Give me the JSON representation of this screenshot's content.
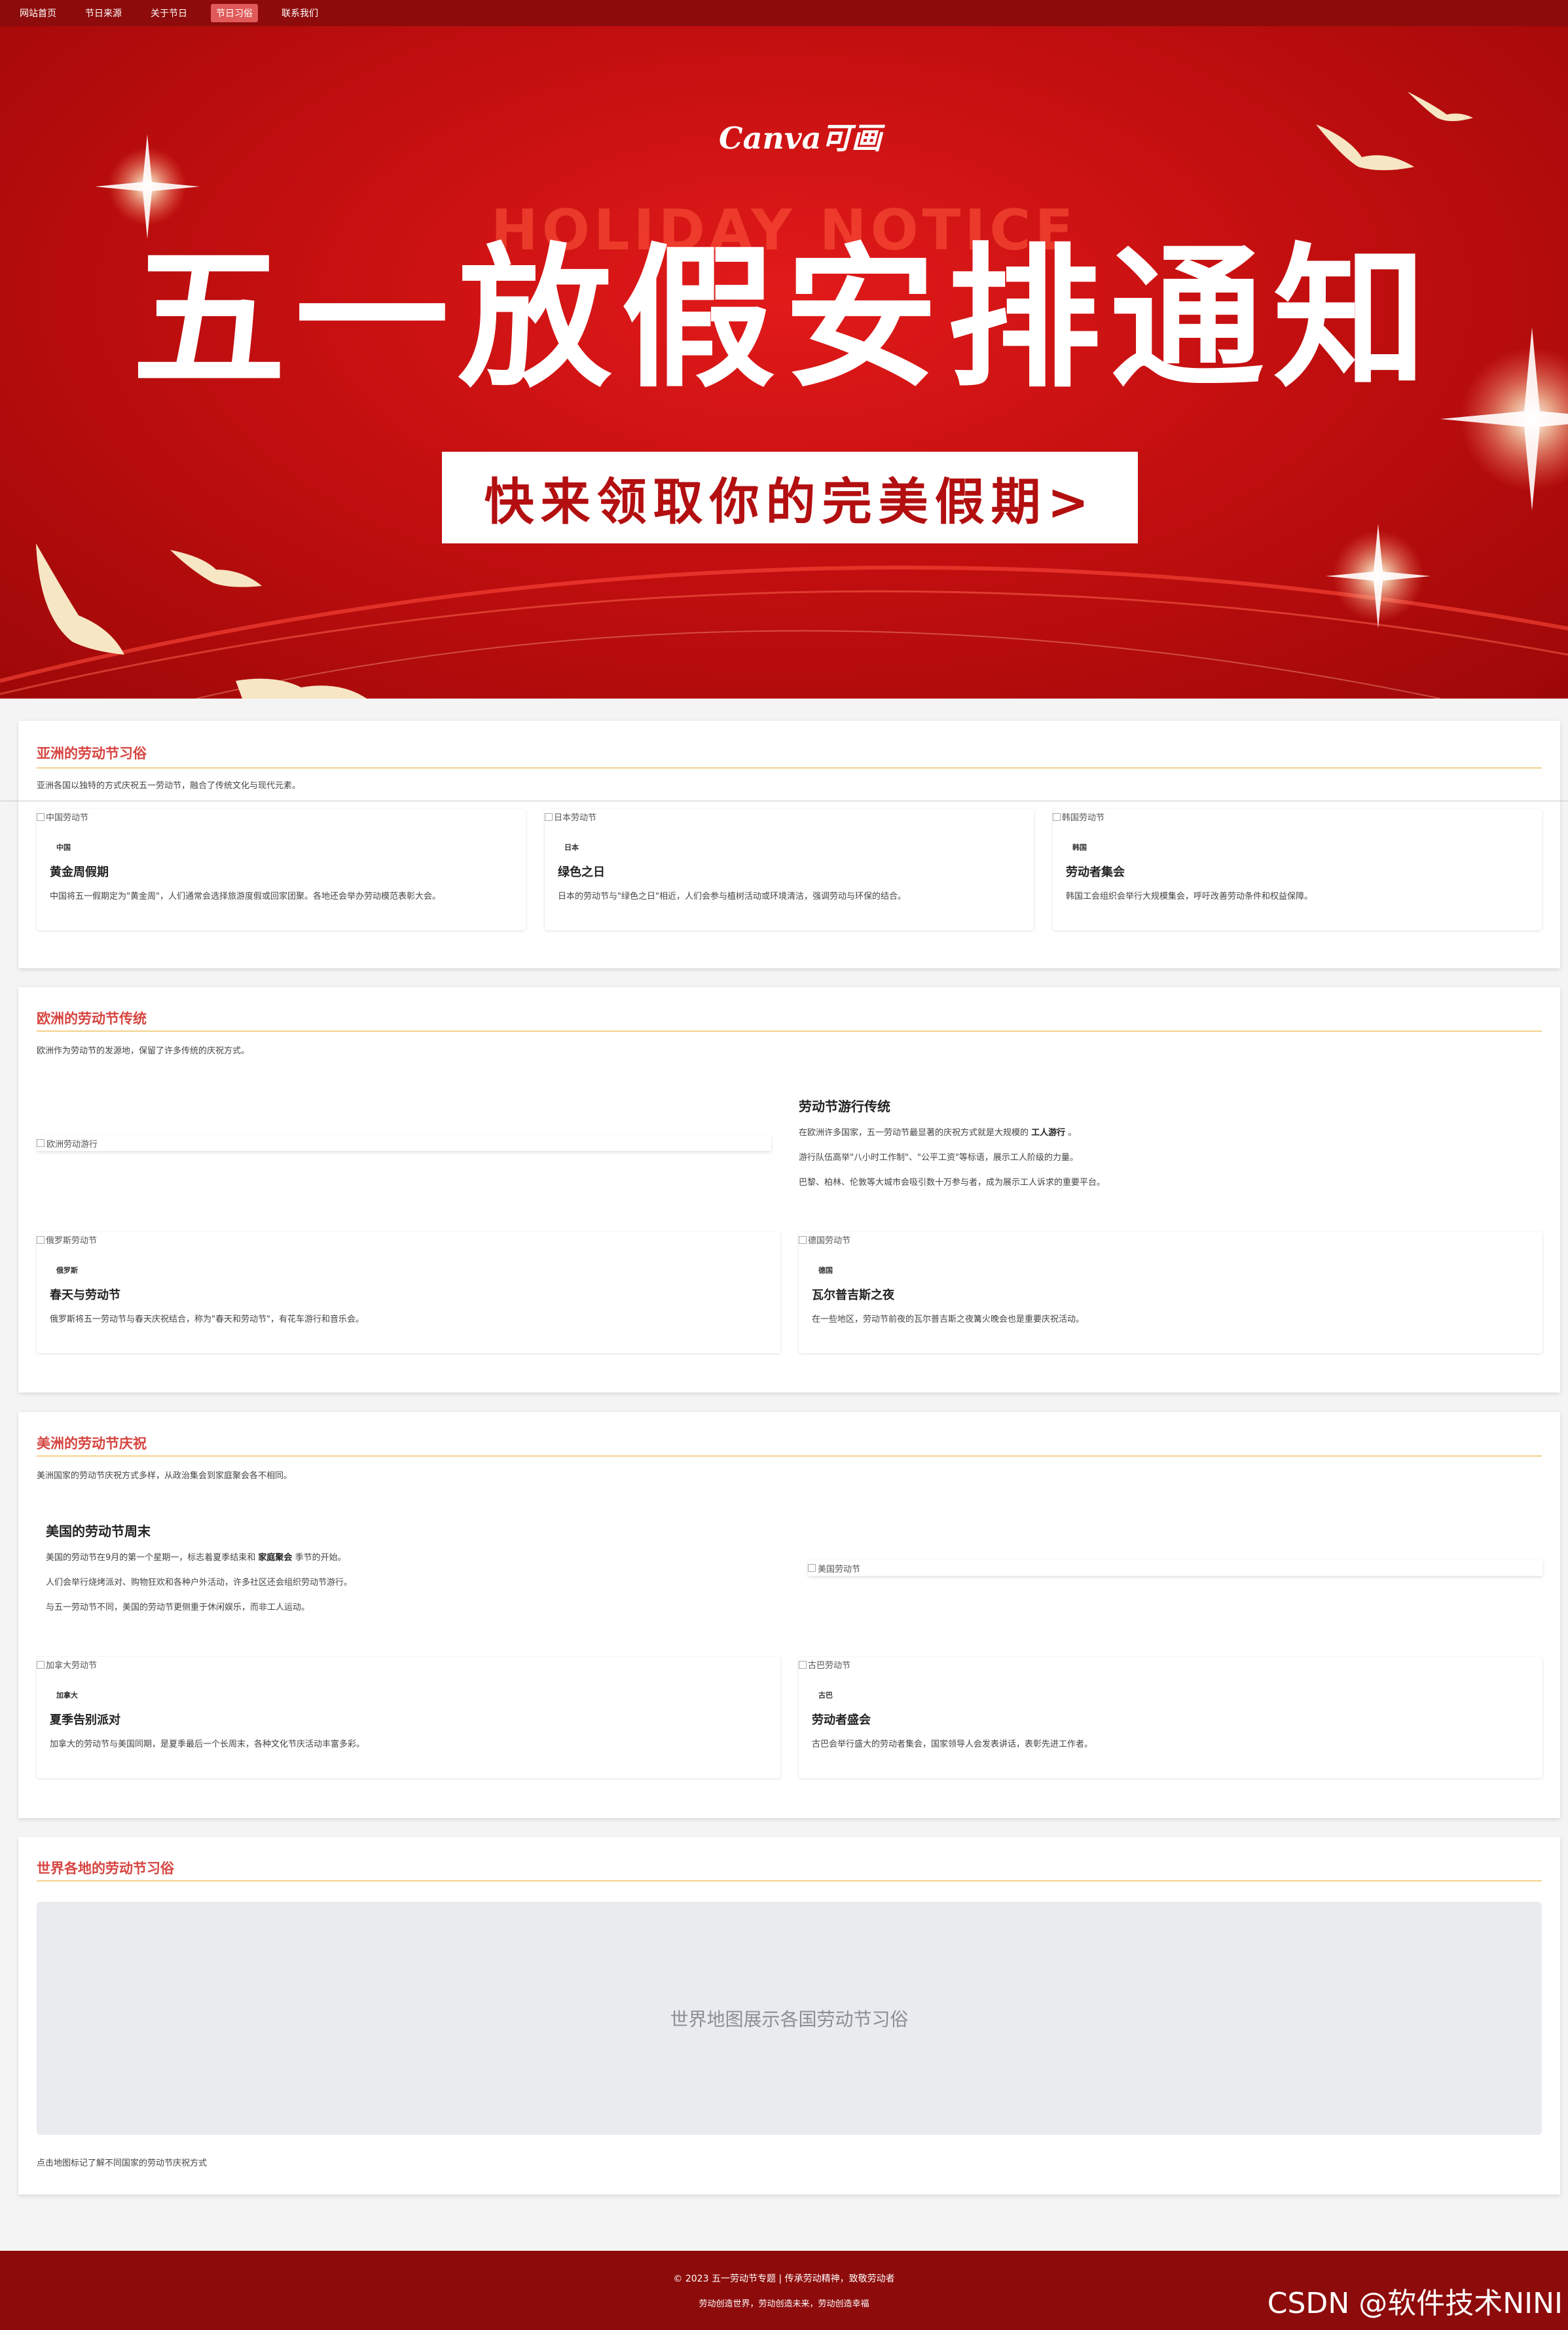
{
  "nav": {
    "items": [
      {
        "label": "网站首页",
        "active": false
      },
      {
        "label": "节日来源",
        "active": false
      },
      {
        "label": "关于节日",
        "active": false
      },
      {
        "label": "节日习俗",
        "active": true
      },
      {
        "label": "联系我们",
        "active": false
      }
    ]
  },
  "hero": {
    "logo": "Canva可画",
    "subtitle": "HOLIDAY NOTICE",
    "title": "五一放假安排通知",
    "cta": "快来领取你的完美假期>"
  },
  "asia": {
    "title": "亚洲的劳动节习俗",
    "desc": "亚洲各国以独特的方式庆祝五一劳动节，融合了传统文化与现代元素。",
    "cards": [
      {
        "img_alt": "中国劳动节",
        "tag": "中国",
        "title": "黄金周假期",
        "text": "中国将五一假期定为\"黄金周\"，人们通常会选择旅游度假或回家团聚。各地还会举办劳动模范表彰大会。"
      },
      {
        "img_alt": "日本劳动节",
        "tag": "日本",
        "title": "绿色之日",
        "text": "日本的劳动节与\"绿色之日\"相近，人们会参与植树活动或环境清洁，强调劳动与环保的结合。"
      },
      {
        "img_alt": "韩国劳动节",
        "tag": "韩国",
        "title": "劳动者集会",
        "text": "韩国工会组织会举行大规模集会，呼吁改善劳动条件和权益保障。"
      }
    ]
  },
  "europe": {
    "title": "欧洲的劳动节传统",
    "desc": "欧洲作为劳动节的发源地，保留了许多传统的庆祝方式。",
    "feature": {
      "img_alt": "欧洲劳动游行",
      "title": "劳动节游行传统",
      "line1_a": "在欧洲许多国家，五一劳动节最显著的庆祝方式就是大规模的",
      "line1_b": "工人游行",
      "line1_c": "。",
      "line2": "游行队伍高举\"八小时工作制\"、\"公平工资\"等标语，展示工人阶级的力量。",
      "line3": "巴黎、柏林、伦敦等大城市会吸引数十万参与者，成为展示工人诉求的重要平台。"
    },
    "cards": [
      {
        "img_alt": "俄罗斯劳动节",
        "tag": "俄罗斯",
        "title": "春天与劳动节",
        "text": "俄罗斯将五一劳动节与春天庆祝结合，称为\"春天和劳动节\"，有花车游行和音乐会。"
      },
      {
        "img_alt": "德国劳动节",
        "tag": "德国",
        "title": "瓦尔普吉斯之夜",
        "text": "在一些地区，劳动节前夜的瓦尔普吉斯之夜篝火晚会也是重要庆祝活动。"
      }
    ]
  },
  "america": {
    "title": "美洲的劳动节庆祝",
    "desc": "美洲国家的劳动节庆祝方式多样，从政治集会到家庭聚会各不相同。",
    "feature": {
      "img_alt": "美国劳动节",
      "title": "美国的劳动节周末",
      "line1_a": "美国的劳动节在9月的第一个星期一，标志着夏季结束和",
      "line1_b": "家庭聚会",
      "line1_c": "季节的开始。",
      "line2": "人们会举行烧烤派对、购物狂欢和各种户外活动，许多社区还会组织劳动节游行。",
      "line3": "与五一劳动节不同，美国的劳动节更侧重于休闲娱乐，而非工人运动。"
    },
    "cards": [
      {
        "img_alt": "加拿大劳动节",
        "tag": "加拿大",
        "title": "夏季告别派对",
        "text": "加拿大的劳动节与美国同期，是夏季最后一个长周末，各种文化节庆活动丰富多彩。"
      },
      {
        "img_alt": "古巴劳动节",
        "tag": "古巴",
        "title": "劳动者盛会",
        "text": "古巴会举行盛大的劳动者集会，国家领导人会发表讲话，表彰先进工作者。"
      }
    ]
  },
  "world": {
    "title": "世界各地的劳动节习俗",
    "map_placeholder": "世界地图展示各国劳动节习俗",
    "hint": "点击地图标记了解不同国家的劳动节庆祝方式"
  },
  "footer": {
    "line1": "© 2023 五一劳动节专题 | 传承劳动精神，致敬劳动者",
    "line2": "劳动创造世界，劳动创造未来，劳动创造幸福"
  },
  "watermark": "CSDN @软件技术NINI",
  "colors": {
    "nav_bg": "#8e0b0b",
    "accent": "#d64541",
    "rule": "#f3d28a",
    "hero_red": "#c40f10"
  }
}
